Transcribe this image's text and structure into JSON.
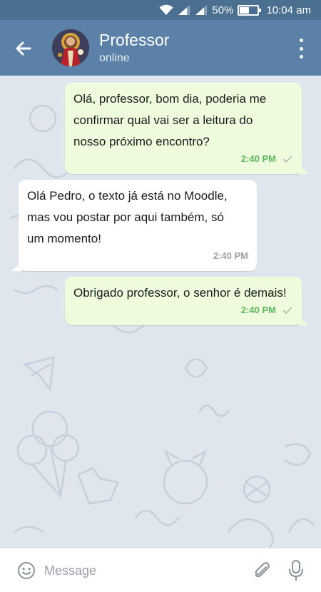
{
  "status_bar": {
    "battery_percent": "50%",
    "battery_level": 0.5,
    "time": "10:04 am",
    "icons": [
      "wifi-icon",
      "signal-icon",
      "signal-icon",
      "battery-icon"
    ]
  },
  "header": {
    "title": "Professor",
    "subtitle": "online",
    "back_icon": "arrow-left-icon",
    "menu_icon": "more-vertical-icon"
  },
  "messages": [
    {
      "direction": "outgoing",
      "lines": [
        "Olá, professor, bom dia, poderia me",
        "confirmar qual vai ser a leitura do",
        "nosso próximo encontro?"
      ],
      "time": "2:40 PM",
      "status_icon": "check-icon"
    },
    {
      "direction": "incoming",
      "lines": [
        "Olá Pedro, o texto já está no Moodle,",
        "mas vou postar por aqui também, só",
        "um momento!"
      ],
      "time": "2:40 PM"
    },
    {
      "direction": "outgoing",
      "lines": [
        "Obrigado professor, o senhor é demais!"
      ],
      "time": "2:40 PM",
      "status_icon": "check-icon"
    }
  ],
  "input_bar": {
    "placeholder": "Message",
    "value": "",
    "icons": [
      "emoji-icon",
      "paperclip-icon",
      "microphone-icon"
    ]
  },
  "colors": {
    "status_bar": "#4a6f91",
    "header": "#5b81a8",
    "chat_background": "#dfe6ee",
    "outgoing_bubble": "#eefcdd",
    "incoming_bubble": "#ffffff",
    "outgoing_time": "#5cb85c"
  }
}
